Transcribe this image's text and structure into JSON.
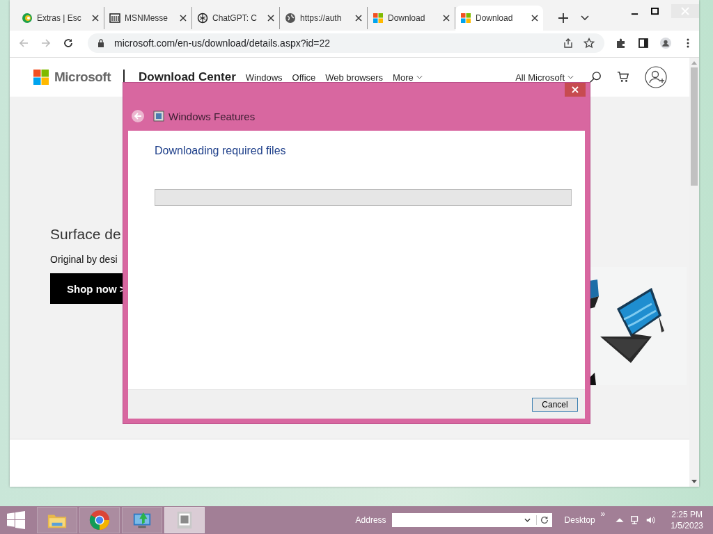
{
  "browser": {
    "tabs": [
      {
        "title": "Extras | Esc",
        "kind": "circle",
        "selected": false
      },
      {
        "title": "MSNMesse",
        "kind": "building",
        "selected": false
      },
      {
        "title": "ChatGPT: C",
        "kind": "knot",
        "selected": false
      },
      {
        "title": "https://auth",
        "kind": "globe",
        "selected": false
      },
      {
        "title": "Download",
        "kind": "squares",
        "selected": false
      },
      {
        "title": "Download",
        "kind": "squares",
        "selected": true
      }
    ],
    "address": "microsoft.com/en-us/download/details.aspx?id=22"
  },
  "site": {
    "brand": "Microsoft",
    "section": "Download Center",
    "nav": [
      "Windows",
      "Office",
      "Web browsers",
      "More"
    ],
    "all_microsoft": "All Microsoft",
    "hero": {
      "title": "Surface de",
      "subtitle": "Original by desi",
      "button": "Shop now >"
    }
  },
  "dialog": {
    "title": "Windows Features",
    "message": "Downloading required files",
    "progress": {
      "level": 0
    },
    "buttons": [
      "Cancel"
    ]
  },
  "taskbar": {
    "apps": [
      {
        "kind": "folder",
        "selected": false
      },
      {
        "kind": "chrome",
        "selected": false
      },
      {
        "kind": "download",
        "selected": false
      },
      {
        "kind": "features",
        "selected": true
      }
    ],
    "address_label": "Address",
    "toolbar": "Desktop",
    "chevron": "»",
    "time": "2:25 PM",
    "date": "1/5/2023"
  }
}
